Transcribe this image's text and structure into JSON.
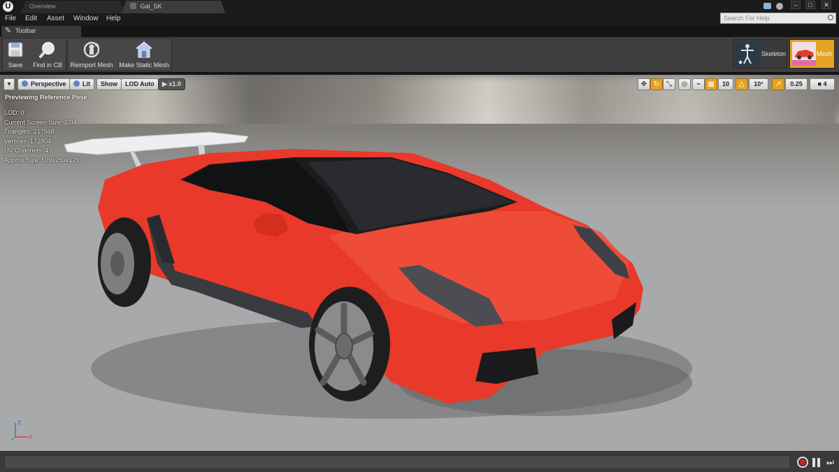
{
  "window": {
    "tabs": [
      {
        "label": "Overview"
      },
      {
        "label": "Gal_SK"
      }
    ],
    "controls": {
      "minimize": "–",
      "maximize": "□",
      "close": "✕"
    }
  },
  "menu": {
    "items": [
      "File",
      "Edit",
      "Asset",
      "Window",
      "Help"
    ],
    "search_placeholder": "Search For Help"
  },
  "panel": {
    "tab_label": "Toolbar"
  },
  "toolbar": {
    "save_label": "Save",
    "find_label": "Find in CB",
    "reimport_label": "Reimport Mesh",
    "make_static_label": "Make Static Mesh"
  },
  "modes": {
    "skeleton_label": "Skeleton",
    "mesh_label": "Mesh"
  },
  "viewport": {
    "perspective_label": "Perspective",
    "lit_label": "Lit",
    "show_label": "Show",
    "lod_label": "LOD Auto",
    "speed_label": "x1.0",
    "grid_snap_value": "10",
    "rotation_snap_value": "10°",
    "scale_snap_value": "0.25",
    "camera_speed_value": "4",
    "preview_label": "Previewing Reference Pose",
    "stats": [
      "LOD: 0",
      "Current Screen Size: 2.04",
      "Triangles: 217568",
      "Vertices: 172804",
      "UV Channels: 4",
      "Approx Size: 509x259x129"
    ],
    "axis": {
      "z": "Z",
      "x": "X"
    }
  },
  "colors": {
    "accent": "#e6a223",
    "car_body": "#e8392a",
    "recording": "#d02020"
  }
}
